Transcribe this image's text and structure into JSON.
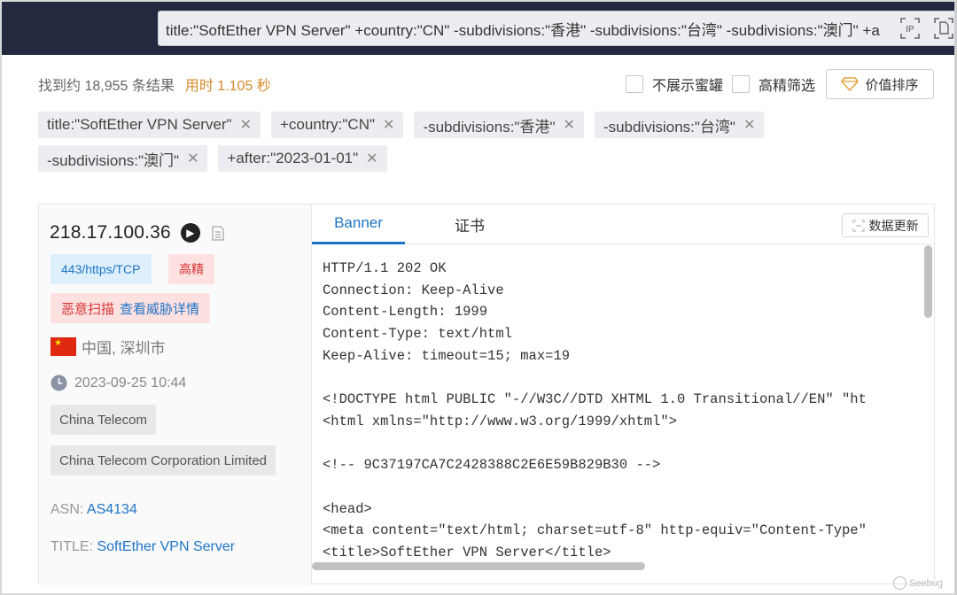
{
  "search": {
    "query": "title:\"SoftEther VPN Server\" +country:\"CN\" -subdivisions:\"香港\" -subdivisions:\"台湾\" -subdivisions:\"澳门\" +a",
    "ip_icon": "ip-scan-icon",
    "doc_icon": "document-icon"
  },
  "summary": {
    "found": "找到约 18,955 条结果",
    "time": "用时 1.105 秒"
  },
  "options": {
    "hide_honeypot": "不展示蜜罐",
    "high_precision": "高精筛选",
    "value_sort": "价值排序"
  },
  "filters": [
    {
      "label": "title:\"SoftEther VPN Server\""
    },
    {
      "label": "+country:\"CN\""
    },
    {
      "label": "-subdivisions:\"香港\""
    },
    {
      "label": "-subdivisions:\"台湾\""
    },
    {
      "label": "-subdivisions:\"澳门\""
    },
    {
      "label": "+after:\"2023-01-01\""
    }
  ],
  "result": {
    "ip": "218.17.100.36",
    "port_tag": "443/https/TCP",
    "precision_tag": "高精",
    "threat_tag": "恶意扫描",
    "threat_link": "查看威胁详情",
    "location": "中国, 深圳市",
    "date": "2023-09-25 10:44",
    "isp": "China Telecom",
    "organization": "China Telecom Corporation Limited",
    "asn_label": "ASN:",
    "asn_value": "AS4134",
    "title_label": "TITLE:",
    "title_value": "SoftEther VPN Server"
  },
  "tabs": {
    "banner": "Banner",
    "certificate": "证书",
    "refresh": "数据更新"
  },
  "banner": {
    "text": "HTTP/1.1 202 OK\nConnection: Keep-Alive\nContent-Length: 1999\nContent-Type: text/html\nKeep-Alive: timeout=15; max=19\n\n<!DOCTYPE html PUBLIC \"-//W3C//DTD XHTML 1.0 Transitional//EN\" \"ht\n<html xmlns=\"http://www.w3.org/1999/xhtml\">\n\n<!-- 9C37197CA7C2428388C2E6E59B829B30 -->\n\n<head>\n<meta content=\"text/html; charset=utf-8\" http-equiv=\"Content-Type\"\n<title>SoftEther VPN Server</title>"
  },
  "watermark": "Seebug",
  "colors": {
    "topbar": "#232a40",
    "link": "#1d74c6",
    "danger": "#d83333",
    "time": "#d88a2c"
  }
}
